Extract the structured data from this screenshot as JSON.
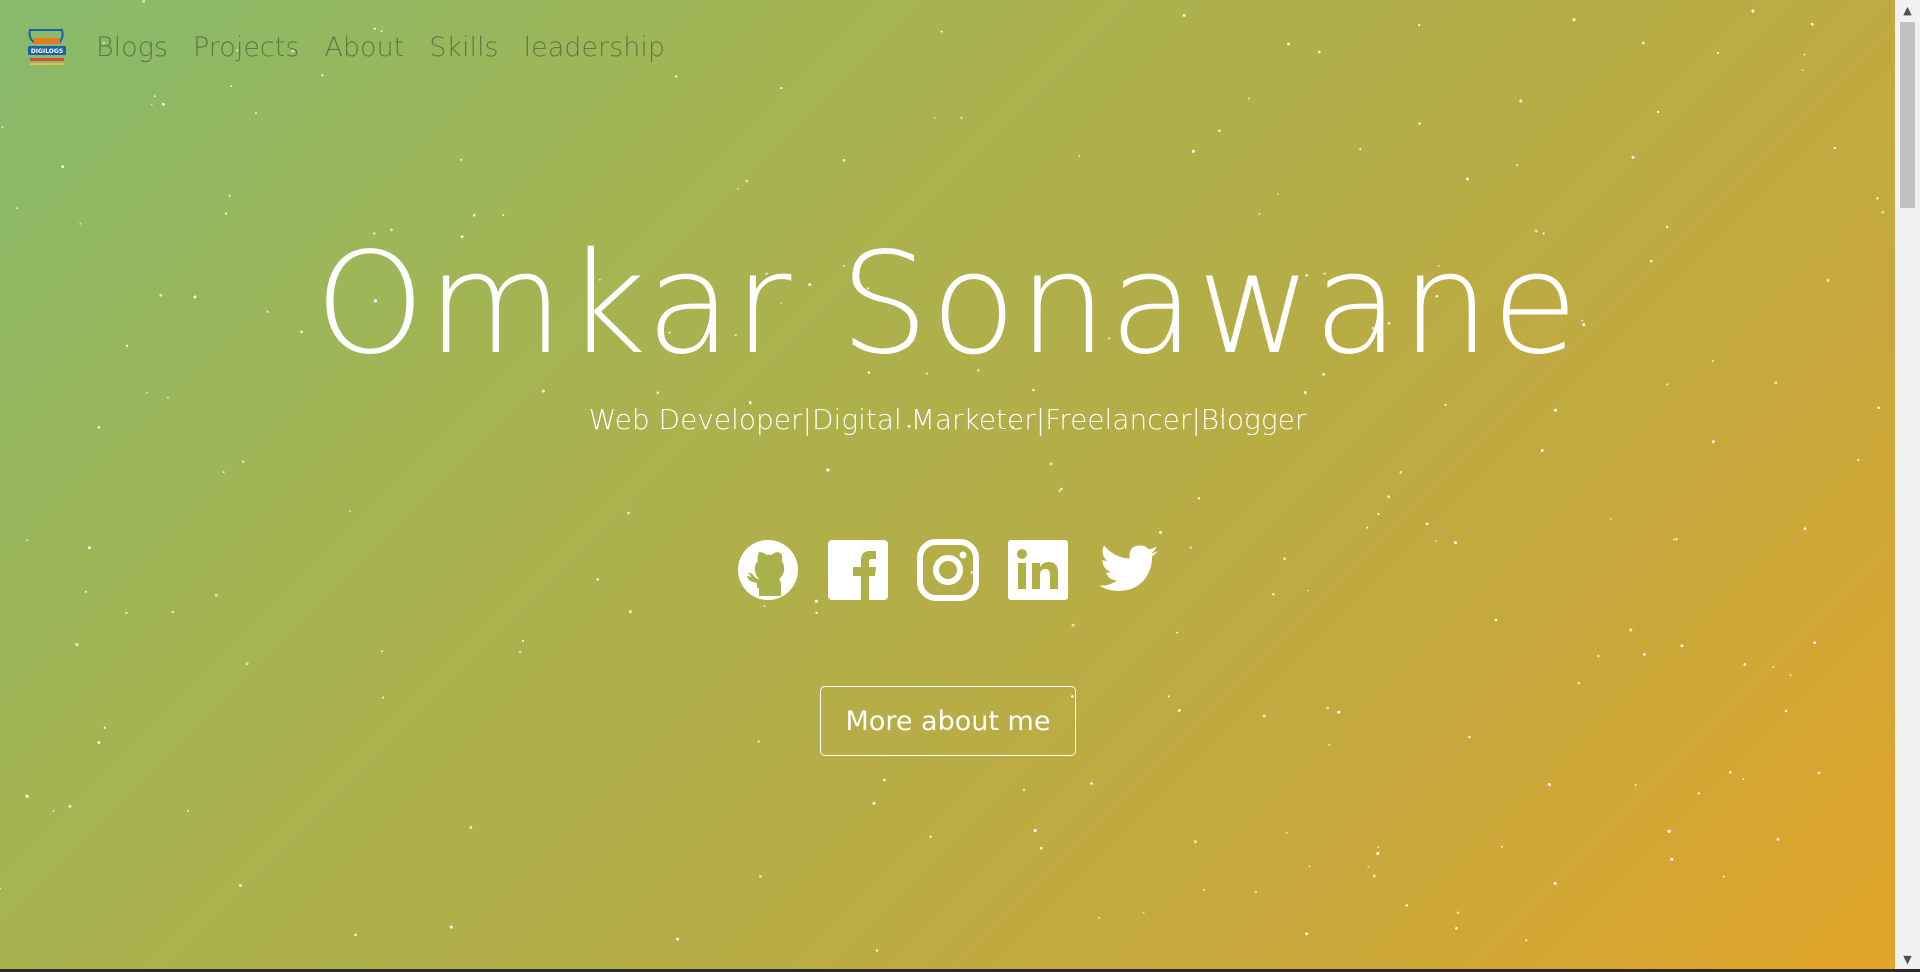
{
  "nav": {
    "logo_name": "digilogo",
    "links": [
      "Blogs",
      "Projects",
      "About",
      "Skills",
      "leadership"
    ]
  },
  "hero": {
    "name": "Omkar Sonawane",
    "tagline": "Web Developer|Digital Marketer|Freelancer|Blogger",
    "socials": [
      "github-icon",
      "facebook-icon",
      "instagram-icon",
      "linkedin-icon",
      "twitter-icon"
    ],
    "cta_label": "More about me"
  },
  "colors": {
    "gradient_start": "#86bb6c",
    "gradient_end": "#e2a42a",
    "text": "#ffffff",
    "nav_text": "#4e6a3a"
  }
}
